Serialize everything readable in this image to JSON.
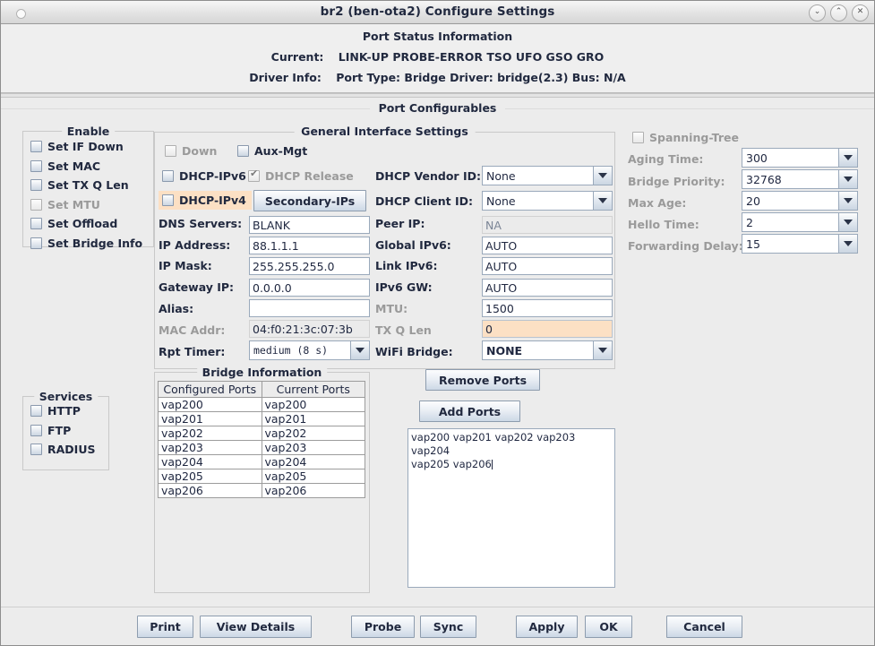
{
  "window": {
    "title": "br2  (ben-ota2) Configure Settings",
    "buttons": [
      {
        "name": "minimize",
        "glyph": "⌄"
      },
      {
        "name": "maximize",
        "glyph": "⌃"
      },
      {
        "name": "close",
        "glyph": "✕"
      }
    ]
  },
  "status": {
    "heading": "Port Status Information",
    "current_label": "Current:",
    "current_value": "LINK-UP PROBE-ERROR TSO UFO GSO GRO",
    "driver_label": "Driver Info:",
    "driver_value": "Port Type: Bridge   Driver: bridge(2.3)  Bus: N/A"
  },
  "port_configurables_title": "Port Configurables",
  "enable": {
    "title": "Enable",
    "items": [
      {
        "label": "Set IF Down",
        "checked": false,
        "disabled": false
      },
      {
        "label": "Set MAC",
        "checked": false,
        "disabled": false
      },
      {
        "label": "Set TX Q Len",
        "checked": false,
        "disabled": false
      },
      {
        "label": "Set MTU",
        "checked": false,
        "disabled": true
      },
      {
        "label": "Set Offload",
        "checked": false,
        "disabled": false
      },
      {
        "label": "Set Bridge Info",
        "checked": false,
        "disabled": false
      }
    ]
  },
  "services": {
    "title": "Services",
    "items": [
      {
        "label": "HTTP",
        "checked": false
      },
      {
        "label": "FTP",
        "checked": false
      },
      {
        "label": "RADIUS",
        "checked": false
      }
    ]
  },
  "general": {
    "title": "General Interface Settings",
    "down": {
      "label": "Down",
      "checked": false,
      "disabled": true
    },
    "aux_mgt": {
      "label": "Aux-Mgt",
      "checked": false,
      "disabled": false
    },
    "dhcp_ipv6": {
      "label": "DHCP-IPv6",
      "checked": false,
      "disabled": false
    },
    "dhcp_release": {
      "label": "DHCP Release",
      "checked": true,
      "disabled": true
    },
    "dhcp_ipv4": {
      "label": "DHCP-IPv4",
      "checked": false,
      "disabled": false,
      "highlight": "#fce0c4"
    },
    "secondary_ips_button": "Secondary-IPs",
    "dhcp_vendor_id": {
      "label": "DHCP Vendor ID:",
      "value": "None"
    },
    "dhcp_client_id": {
      "label": "DHCP Client ID:",
      "value": "None"
    },
    "dns_servers": {
      "label": "DNS Servers:",
      "value": "BLANK"
    },
    "peer_ip": {
      "label": "Peer IP:",
      "value": "NA"
    },
    "ip_address": {
      "label": "IP Address:",
      "value": "88.1.1.1"
    },
    "global_ipv6": {
      "label": "Global IPv6:",
      "value": "AUTO"
    },
    "ip_mask": {
      "label": "IP Mask:",
      "value": "255.255.255.0"
    },
    "link_ipv6": {
      "label": "Link IPv6:",
      "value": "AUTO"
    },
    "gateway_ip": {
      "label": "Gateway IP:",
      "value": "0.0.0.0"
    },
    "ipv6_gw": {
      "label": "IPv6 GW:",
      "value": "AUTO"
    },
    "alias": {
      "label": "Alias:",
      "value": ""
    },
    "mtu": {
      "label": "MTU:",
      "value": "1500"
    },
    "mac_addr": {
      "label": "MAC Addr:",
      "value": "04:f0:21:3c:07:3b"
    },
    "tx_q_len": {
      "label": "TX Q Len",
      "value": "0"
    },
    "rpt_timer": {
      "label": "Rpt Timer:",
      "value": "medium  (8 s)"
    },
    "wifi_bridge": {
      "label": "WiFi Bridge:",
      "value": "NONE"
    }
  },
  "spanning": {
    "checkbox_label": "Spanning-Tree",
    "aging_time": {
      "label": "Aging Time:",
      "value": "300"
    },
    "bridge_priority": {
      "label": "Bridge Priority:",
      "value": "32768"
    },
    "max_age": {
      "label": "Max Age:",
      "value": "20"
    },
    "hello_time": {
      "label": "Hello Time:",
      "value": "2"
    },
    "forwarding_delay": {
      "label": "Forwarding Delay:",
      "value": "15"
    }
  },
  "bridge": {
    "title": "Bridge Information",
    "columns": [
      "Configured Ports",
      "Current Ports"
    ],
    "rows": [
      [
        "vap200",
        "vap200"
      ],
      [
        "vap201",
        "vap201"
      ],
      [
        "vap202",
        "vap202"
      ],
      [
        "vap203",
        "vap203"
      ],
      [
        "vap204",
        "vap204"
      ],
      [
        "vap205",
        "vap205"
      ],
      [
        "vap206",
        "vap206"
      ]
    ]
  },
  "ports_actions": {
    "remove_ports": "Remove Ports",
    "add_ports": "Add Ports",
    "ports_textarea": "vap200 vap201 vap202 vap203 vap204\nvap205 vap206"
  },
  "footer": {
    "print": "Print",
    "view_details": "View Details",
    "probe": "Probe",
    "sync": "Sync",
    "apply": "Apply",
    "ok": "OK",
    "cancel": "Cancel"
  }
}
